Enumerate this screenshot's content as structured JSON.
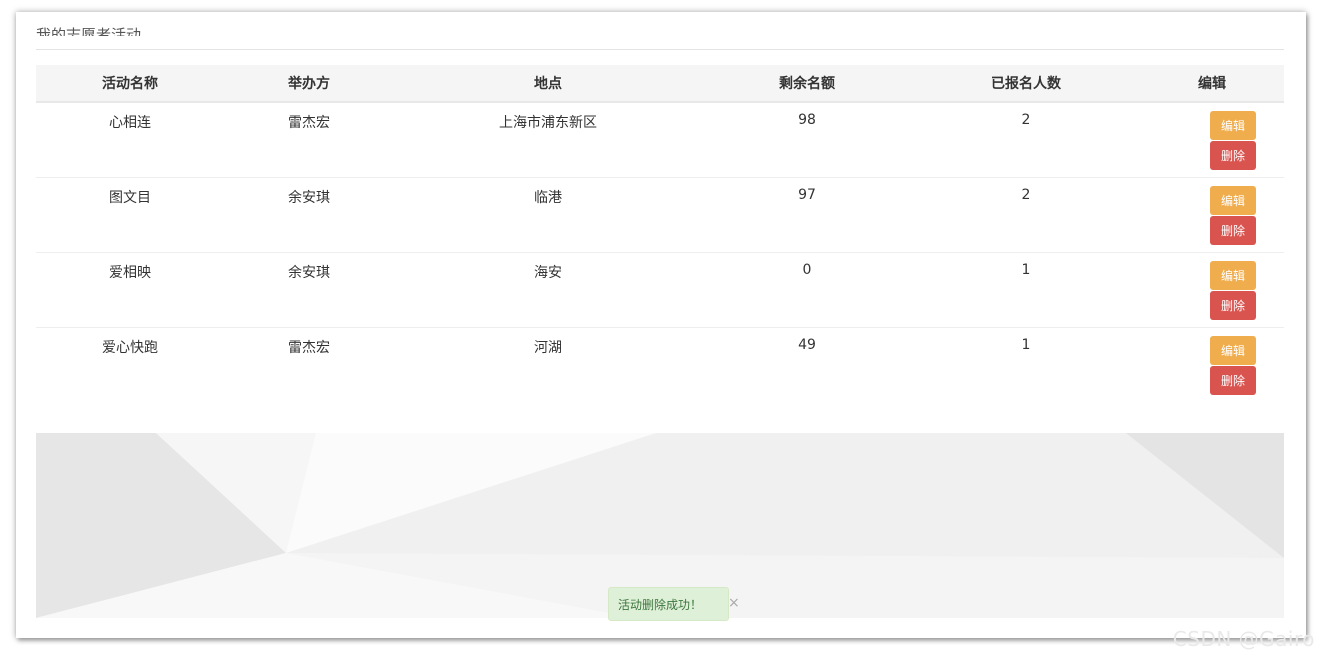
{
  "section_title": "我的志愿者活动",
  "table": {
    "headers": {
      "name": "活动名称",
      "organizer": "举办方",
      "location": "地点",
      "remaining": "剩余名额",
      "registered": "已报名人数",
      "edit": "编辑"
    },
    "rows": [
      {
        "name": "心相连",
        "organizer": "雷杰宏",
        "location": "上海市浦东新区",
        "remaining": "98",
        "registered": "2",
        "edit_label": "编辑",
        "delete_label": "删除"
      },
      {
        "name": "图文目",
        "organizer": "余安琪",
        "location": "临港",
        "remaining": "97",
        "registered": "2",
        "edit_label": "编辑",
        "delete_label": "删除"
      },
      {
        "name": "爱相映",
        "organizer": "余安琪",
        "location": "海安",
        "remaining": "0",
        "registered": "1",
        "edit_label": "编辑",
        "delete_label": "删除"
      },
      {
        "name": "爱心快跑",
        "organizer": "雷杰宏",
        "location": "河湖",
        "remaining": "49",
        "registered": "1",
        "edit_label": "编辑",
        "delete_label": "删除"
      }
    ]
  },
  "toast": {
    "message": "活动删除成功！",
    "close_icon": "×"
  },
  "watermark": "CSDN @Gairo",
  "colors": {
    "edit_button": "#f0ad4e",
    "delete_button": "#d9534f",
    "toast_bg": "#dff0d8",
    "toast_text": "#3c763d"
  }
}
